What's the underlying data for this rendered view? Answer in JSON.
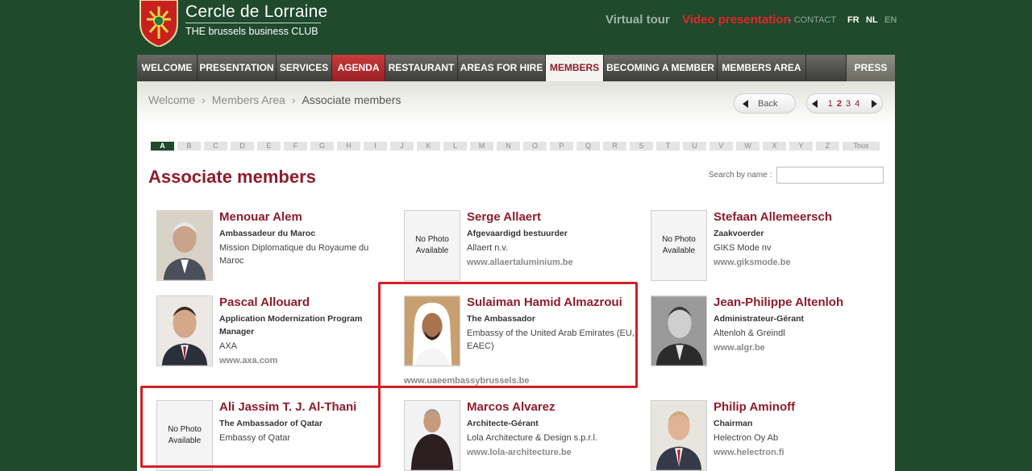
{
  "header": {
    "brand_title": "Cercle de Lorraine",
    "brand_subtitle": "THE brussels business CLUB",
    "links": {
      "virtual_tour": "Virtual tour",
      "video_presentation": "Video presentation",
      "contact": "- CONTACT"
    },
    "languages": [
      "FR",
      "NL",
      "EN"
    ]
  },
  "nav": [
    "WELCOME",
    "PRESENTATION",
    "SERVICES",
    "AGENDA",
    "RESTAURANT",
    "AREAS FOR HIRE",
    "MEMBERS",
    "BECOMING A MEMBER",
    "MEMBERS AREA",
    "PRESS"
  ],
  "breadcrumb": [
    "Welcome",
    "Members Area",
    "Associate members"
  ],
  "back_label": "Back",
  "pager": [
    "1",
    "2",
    "3",
    "4"
  ],
  "current_page": "2",
  "alphabet": [
    "A",
    "B",
    "C",
    "D",
    "E",
    "F",
    "G",
    "H",
    "I",
    "J",
    "K",
    "L",
    "M",
    "N",
    "O",
    "P",
    "Q",
    "R",
    "S",
    "T",
    "U",
    "V",
    "W",
    "X",
    "Y",
    "Z",
    "Tous"
  ],
  "active_letter": "A",
  "page_title": "Associate members",
  "search_label": "Search by name :",
  "no_photo": [
    "No Photo",
    "Available"
  ],
  "members": [
    {
      "name": "Menouar Alem",
      "role": "Ambassadeur du Maroc",
      "org": "Mission Diplomatique du Royaume du Maroc",
      "web": "",
      "photo": "portrait-gray-hair"
    },
    {
      "name": "Serge Allaert",
      "role": "Afgevaardigd bestuurder",
      "org": "Allaert n.v.",
      "web": "www.allaertaluminium.be",
      "photo": "none"
    },
    {
      "name": "Stefaan Allemeersch",
      "role": "Zaakvoerder",
      "org": "GIKS Mode nv",
      "web": "www.giksmode.be",
      "photo": "none"
    },
    {
      "name": "Pascal Allouard",
      "role": "Application Modernization Program Manager",
      "org": "AXA",
      "web": "www.axa.com",
      "photo": "portrait-suit"
    },
    {
      "name": "Sulaiman Hamid Almazroui",
      "role": "The Ambassador",
      "org": "Embassy of the United Arab Emirates (EU, EAEC)",
      "web": "www.uaeembassybrussels.be",
      "photo": "portrait-headdress"
    },
    {
      "name": "Jean-Philippe Altenloh",
      "role": "Administrateur-Gérant",
      "org": "Altenloh & Greindl",
      "web": "www.algr.be",
      "photo": "portrait-bw"
    },
    {
      "name": "Ali Jassim T. J. Al-Thani",
      "role": "The Ambassador of Qatar",
      "org": "Embassy of Qatar",
      "web": "",
      "photo": "none"
    },
    {
      "name": "Marcos Alvarez",
      "role": "Architecte-Gérant",
      "org": "Lola Architecture & Design s.p.r.l.",
      "web": "www.lola-architecture.be",
      "photo": "portrait-casual"
    },
    {
      "name": "Philip Aminoff",
      "role": "Chairman",
      "org": "Helectron Oy Ab",
      "web": "www.helectron.fi",
      "photo": "portrait-tie"
    }
  ],
  "colors": {
    "background": "#1f4a2b",
    "accent": "#8e1c2b",
    "highlight": "#d41f26",
    "link_red": "#e4242b"
  }
}
